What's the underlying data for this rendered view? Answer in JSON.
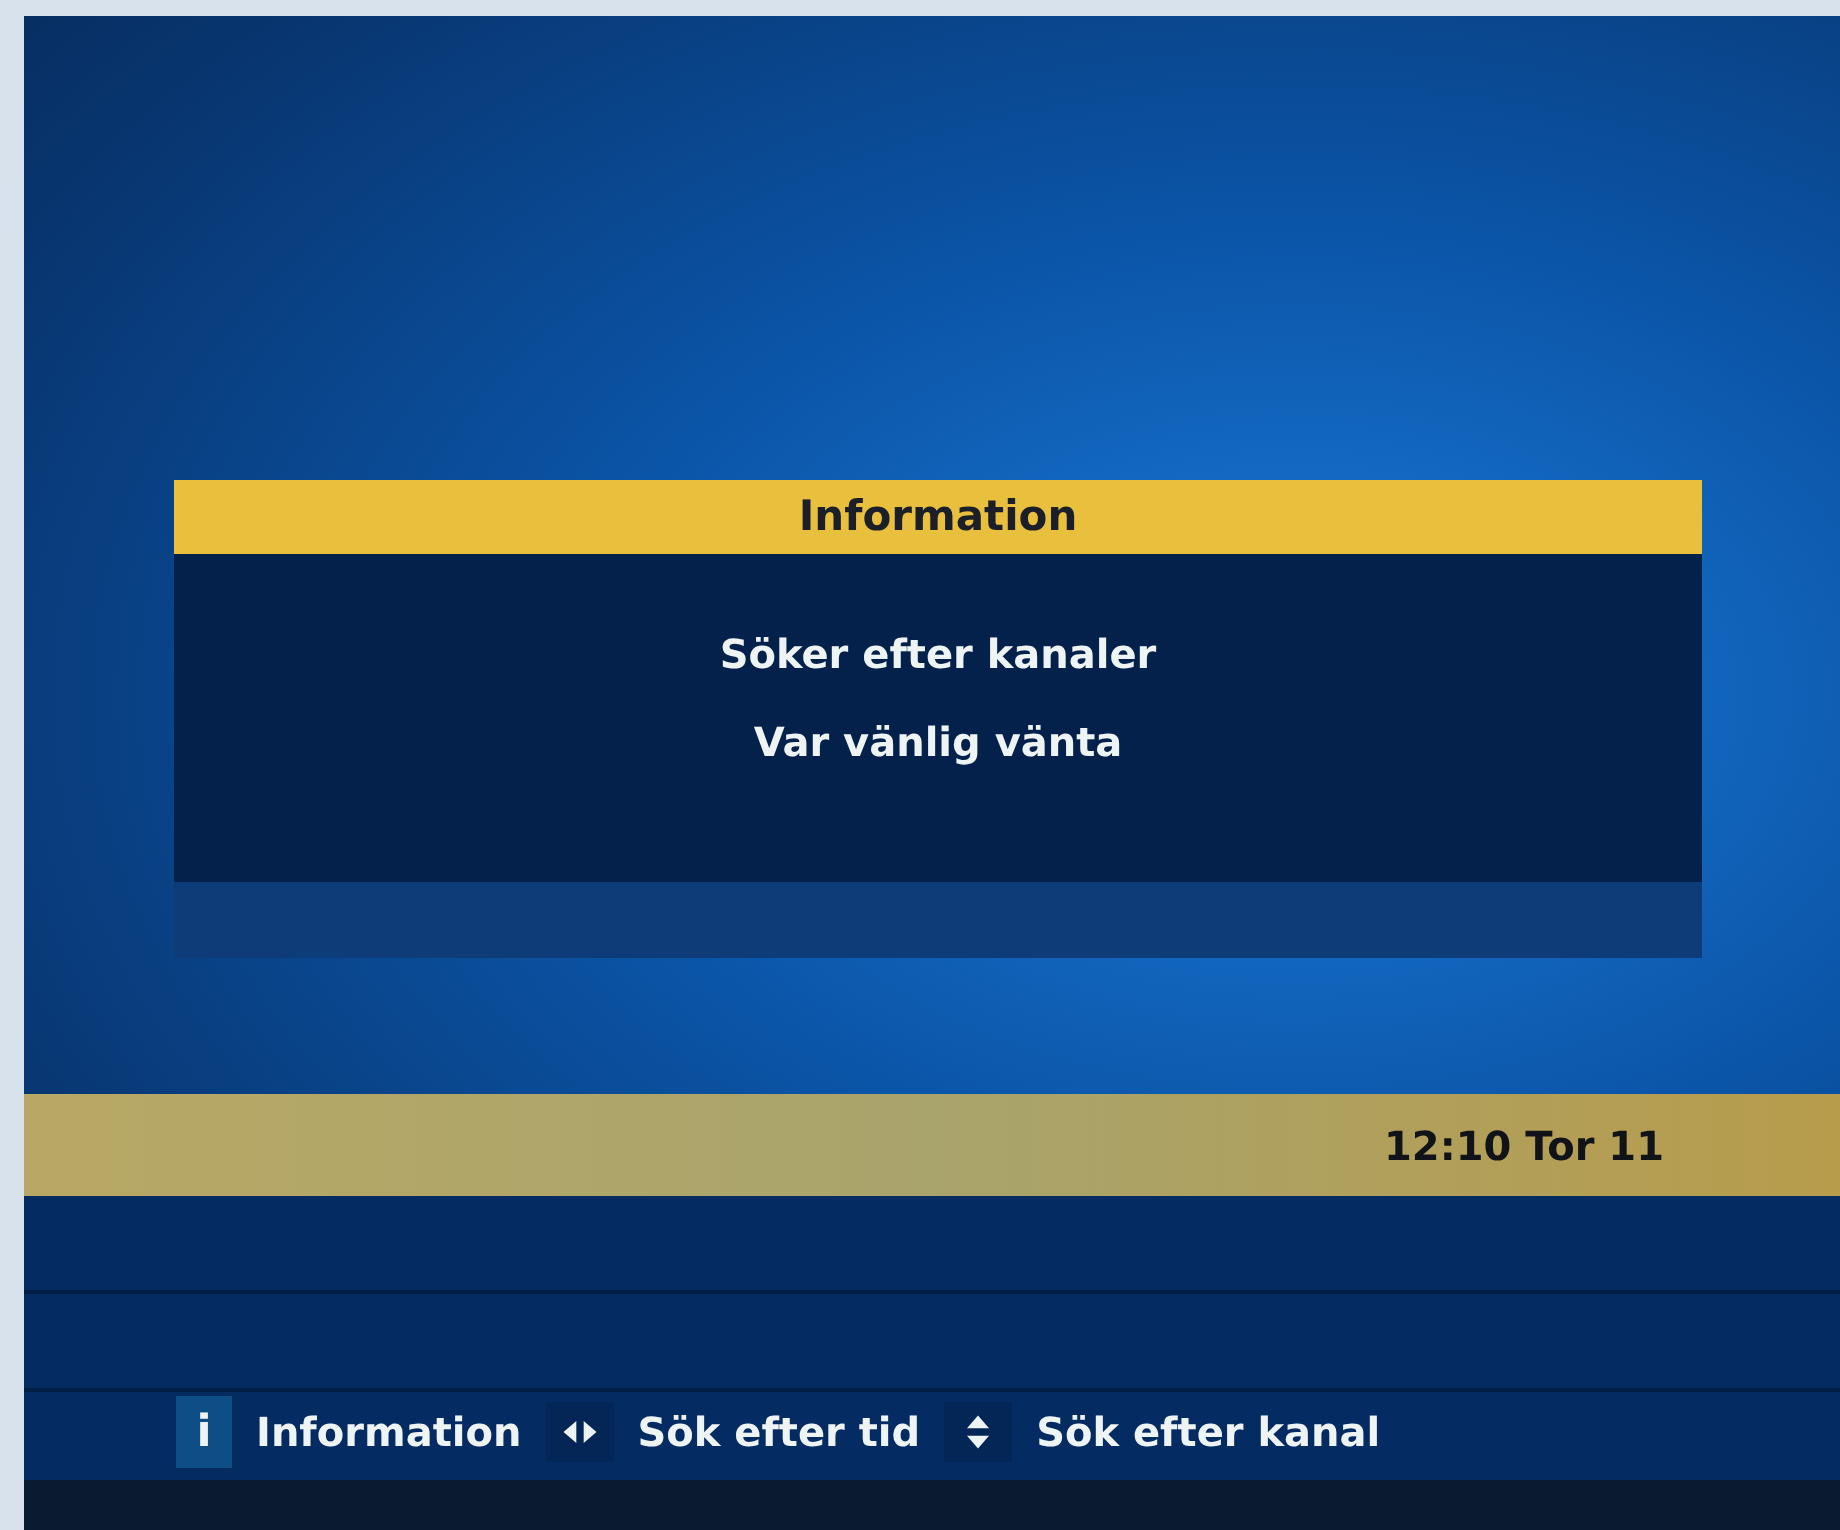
{
  "dialog": {
    "title": "Information",
    "lines": [
      "Söker efter kanaler",
      "Var vänlig vänta"
    ]
  },
  "status_bar": {
    "clock": "12:10 Tor 11"
  },
  "hints": [
    {
      "kind": "info",
      "key": "i",
      "label": "Information"
    },
    {
      "kind": "left-right",
      "label": "Sök efter tid"
    },
    {
      "kind": "up-down",
      "label": "Sök efter kanal"
    }
  ]
}
